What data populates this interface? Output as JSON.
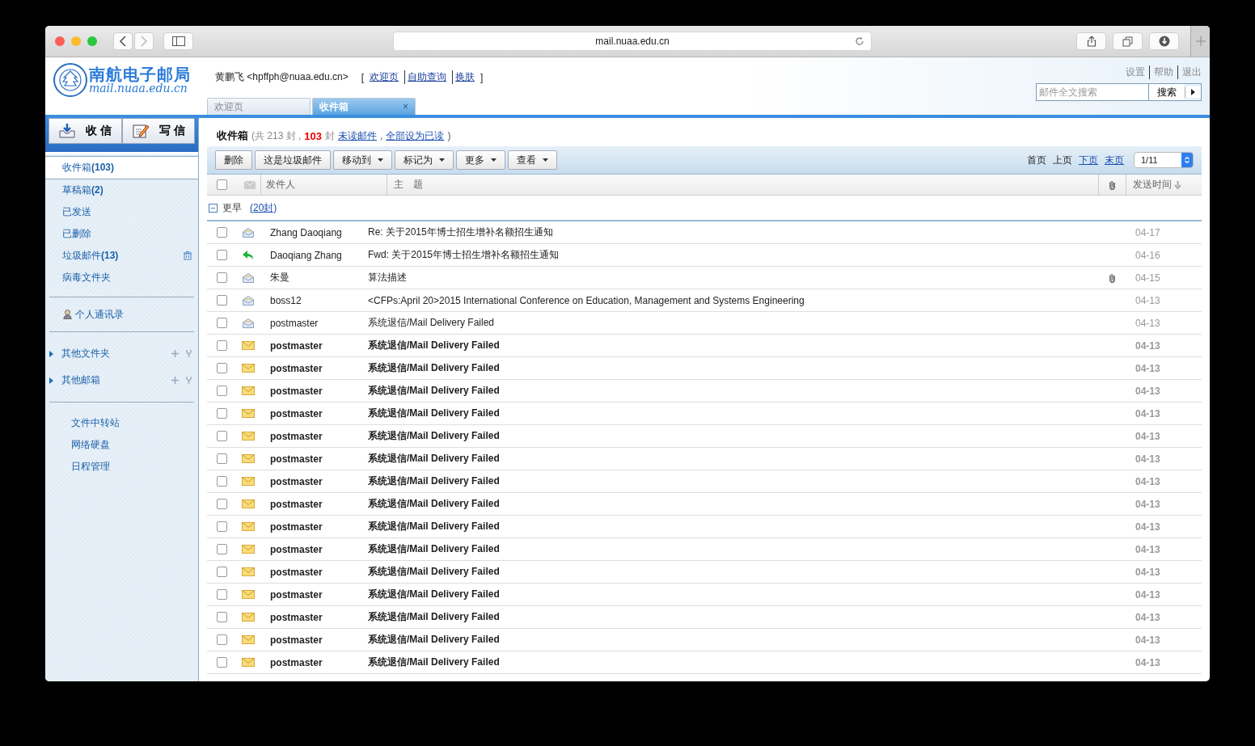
{
  "browser": {
    "url": "mail.nuaa.edu.cn"
  },
  "header": {
    "logo_title": "南航电子邮局",
    "logo_domain": "mail.nuaa.edu.cn",
    "user": "黄鹏飞 <hpffph@nuaa.edu.cn>",
    "bracket_open": "[",
    "bracket_close": "]",
    "links": [
      "欢迎页",
      "自助查询",
      "换肤"
    ],
    "tabs": [
      {
        "label": "欢迎页",
        "selected": false
      },
      {
        "label": "收件箱",
        "selected": true,
        "close": "×"
      }
    ],
    "top_links": [
      "设置",
      "帮助",
      "退出"
    ],
    "search": {
      "placeholder": "邮件全文搜索",
      "button": "搜索"
    }
  },
  "sidebar": {
    "actions": [
      {
        "kind": "receive",
        "label": "收 信"
      },
      {
        "kind": "compose",
        "label": "写 信"
      }
    ],
    "folders": [
      {
        "label": "收件箱**(103)**",
        "selected": true,
        "trash": false
      },
      {
        "label": "草稿箱**(2)**",
        "selected": false,
        "trash": false
      },
      {
        "label": "已发送",
        "selected": false,
        "trash": false
      },
      {
        "label": "已删除",
        "selected": false,
        "trash": false
      },
      {
        "label": "垃圾邮件**(13)**",
        "selected": false,
        "trash": true
      },
      {
        "label": "病毒文件夹",
        "selected": false,
        "trash": false
      }
    ],
    "contacts": "个人通讯录",
    "groups": [
      {
        "label": "其他文件夹",
        "expanded": false
      },
      {
        "label": "其他邮箱",
        "expanded": false
      }
    ],
    "tools": [
      "文件中转站",
      "网络硬盘",
      "日程管理"
    ]
  },
  "main": {
    "title": "收件箱",
    "total": "(共 213 封 ,",
    "unread_count": "103",
    "unread_suffix": "封",
    "unread_link": "未读邮件",
    "separator": ",",
    "mark_all_link": "全部设为已读",
    "close": ")",
    "toolbar": [
      {
        "label": "删除",
        "dropdown": false
      },
      {
        "label": "这是垃圾邮件",
        "dropdown": false
      },
      {
        "label": "移动到",
        "dropdown": true
      },
      {
        "label": "标记为",
        "dropdown": true
      },
      {
        "label": "更多",
        "dropdown": true
      },
      {
        "label": "查看",
        "dropdown": true
      }
    ],
    "pager": [
      {
        "label": "首页",
        "disabled": true
      },
      {
        "label": "上页",
        "disabled": true
      },
      {
        "label": "下页",
        "disabled": false
      },
      {
        "label": "末页",
        "disabled": false
      }
    ],
    "page": "1/11",
    "select_all_checked": false,
    "columns": {
      "sender": "发件人",
      "subject": "主　题",
      "date": "发送时间"
    },
    "group": {
      "label": "更早",
      "count": "(20封)",
      "expanded": true
    },
    "rows": [
      {
        "kind": "read",
        "sender": "Zhang Daoqiang",
        "subject": "Re: 关于2015年博士招生增补名额招生通知",
        "date": "04-17",
        "unread": false,
        "attachment": false,
        "checked": false
      },
      {
        "kind": "replied",
        "sender": "Daoqiang Zhang",
        "subject": "Fwd: 关于2015年博士招生增补名额招生通知",
        "date": "04-16",
        "unread": false,
        "attachment": false,
        "checked": false
      },
      {
        "kind": "read",
        "sender": "朱曼",
        "subject": "算法描述",
        "date": "04-15",
        "unread": false,
        "attachment": true,
        "checked": false
      },
      {
        "kind": "read",
        "sender": "boss12",
        "subject": "<CFPs:April 20>2015 International Conference on Education, Management and Systems Engineering",
        "date": "04-13",
        "unread": false,
        "attachment": false,
        "checked": false
      },
      {
        "kind": "read",
        "sender": "postmaster",
        "subject": "系统退信/Mail Delivery Failed",
        "date": "04-13",
        "unread": false,
        "attachment": false,
        "checked": false
      },
      {
        "kind": "new",
        "sender": "postmaster",
        "subject": "系统退信/Mail Delivery Failed",
        "date": "04-13",
        "unread": true,
        "attachment": false,
        "checked": false
      },
      {
        "kind": "new",
        "sender": "postmaster",
        "subject": "系统退信/Mail Delivery Failed",
        "date": "04-13",
        "unread": true,
        "attachment": false,
        "checked": false
      },
      {
        "kind": "new",
        "sender": "postmaster",
        "subject": "系统退信/Mail Delivery Failed",
        "date": "04-13",
        "unread": true,
        "attachment": false,
        "checked": false
      },
      {
        "kind": "new",
        "sender": "postmaster",
        "subject": "系统退信/Mail Delivery Failed",
        "date": "04-13",
        "unread": true,
        "attachment": false,
        "checked": false
      },
      {
        "kind": "new",
        "sender": "postmaster",
        "subject": "系统退信/Mail Delivery Failed",
        "date": "04-13",
        "unread": true,
        "attachment": false,
        "checked": false
      },
      {
        "kind": "new",
        "sender": "postmaster",
        "subject": "系统退信/Mail Delivery Failed",
        "date": "04-13",
        "unread": true,
        "attachment": false,
        "checked": false
      },
      {
        "kind": "new",
        "sender": "postmaster",
        "subject": "系统退信/Mail Delivery Failed",
        "date": "04-13",
        "unread": true,
        "attachment": false,
        "checked": false
      },
      {
        "kind": "new",
        "sender": "postmaster",
        "subject": "系统退信/Mail Delivery Failed",
        "date": "04-13",
        "unread": true,
        "attachment": false,
        "checked": false
      },
      {
        "kind": "new",
        "sender": "postmaster",
        "subject": "系统退信/Mail Delivery Failed",
        "date": "04-13",
        "unread": true,
        "attachment": false,
        "checked": false
      },
      {
        "kind": "new",
        "sender": "postmaster",
        "subject": "系统退信/Mail Delivery Failed",
        "date": "04-13",
        "unread": true,
        "attachment": false,
        "checked": false
      },
      {
        "kind": "new",
        "sender": "postmaster",
        "subject": "系统退信/Mail Delivery Failed",
        "date": "04-13",
        "unread": true,
        "attachment": false,
        "checked": false
      },
      {
        "kind": "new",
        "sender": "postmaster",
        "subject": "系统退信/Mail Delivery Failed",
        "date": "04-13",
        "unread": true,
        "attachment": false,
        "checked": false
      },
      {
        "kind": "new",
        "sender": "postmaster",
        "subject": "系统退信/Mail Delivery Failed",
        "date": "04-13",
        "unread": true,
        "attachment": false,
        "checked": false
      },
      {
        "kind": "new",
        "sender": "postmaster",
        "subject": "系统退信/Mail Delivery Failed",
        "date": "04-13",
        "unread": true,
        "attachment": false,
        "checked": false
      },
      {
        "kind": "new",
        "sender": "postmaster",
        "subject": "系统退信/Mail Delivery Failed",
        "date": "04-13",
        "unread": true,
        "attachment": false,
        "checked": false
      }
    ]
  }
}
